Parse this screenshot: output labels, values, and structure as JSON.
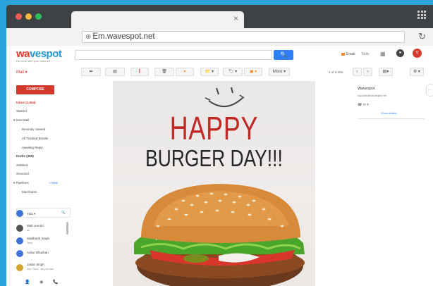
{
  "browser": {
    "url": "Em.wavespot.net",
    "tab_close": "×",
    "reload": "↻"
  },
  "header": {
    "logo_a": "wa",
    "logo_b": "vespot",
    "tagline": "Do more with your internet!",
    "search_icon": "🔍",
    "email_label": "Email",
    "tools_label": "Tools",
    "apps_icon": "▦",
    "avatar_initial": "Y"
  },
  "toolbar": {
    "mail_label": "Mail ▾",
    "back": "⬅",
    "archive": "▤",
    "spam": "❗",
    "delete": "🗑",
    "label_btn": "▾",
    "folder": "📁 ▾",
    "tag": "🏷 ▾",
    "app": "▣ ▾",
    "more": "More ▾",
    "pager": "2 of 6,009",
    "prev": "‹",
    "next": "›",
    "view": "▤▾",
    "settings": "⚙ ▾"
  },
  "nav": {
    "compose": "COMPOSE",
    "items": [
      "Inbox (1,664)",
      "Starred",
      "▾ Sent Mail",
      "Recently Viewed",
      "All Tracked Emails",
      "Awaiting Reply",
      "Drafts (368)",
      "Sidekick",
      "Snoozed",
      "▾ Pipelines",
      "Merchants"
    ],
    "new_link": "+ New",
    "contact_user": "Yula ▾",
    "contacts": [
      {
        "name": "Matt Jerrold",
        "sub": "ok"
      },
      {
        "name": "Siddharth Singh",
        "sub": "Yess"
      },
      {
        "name": "Ankur Bhushan",
        "sub": ""
      },
      {
        "name": "Jasbir Singh",
        "sub": "You: Sure.. as you hav"
      }
    ],
    "bottom_icons": "👤 ◉ 📞"
  },
  "email": {
    "headline": "HAPPY",
    "subline": "BURGER DAY!!!"
  },
  "right_pane": {
    "name": "Wavespot",
    "email": "support@wavespot.net",
    "icons": "☎ ✉ ▾",
    "details": "Show details"
  }
}
